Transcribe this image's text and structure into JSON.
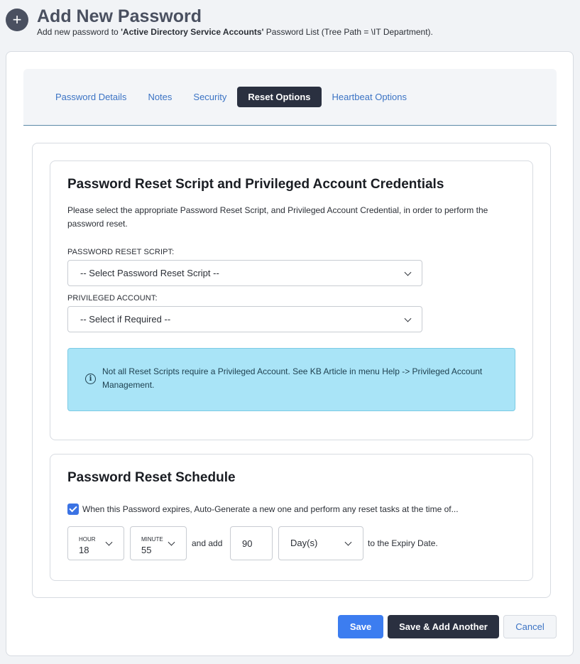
{
  "header": {
    "title": "Add New Password",
    "subtitle_prefix": "Add new password to ",
    "list_name": "'Active Directory Service Accounts'",
    "subtitle_suffix": " Password List (Tree Path = \\IT Department)."
  },
  "tabs": [
    {
      "label": "Password Details",
      "active": false
    },
    {
      "label": "Notes",
      "active": false
    },
    {
      "label": "Security",
      "active": false
    },
    {
      "label": "Reset Options",
      "active": true
    },
    {
      "label": "Heartbeat Options",
      "active": false
    }
  ],
  "reset_section": {
    "title": "Password Reset Script and Privileged Account Credentials",
    "description": "Please select the appropriate Password Reset Script, and Privileged Account Credential, in order to perform the password reset.",
    "script_label": "PASSWORD RESET SCRIPT:",
    "script_value": "-- Select Password Reset Script --",
    "account_label": "PRIVILEGED ACCOUNT:",
    "account_value": "-- Select if Required --",
    "info_text": "Not all Reset Scripts require a Privileged Account. See KB Article in menu Help -> Privileged Account Management."
  },
  "schedule_section": {
    "title": "Password Reset Schedule",
    "checkbox_label": "When this Password expires, Auto-Generate a new one and perform any reset tasks at the time of...",
    "checkbox_checked": true,
    "hour_label": "HOUR",
    "hour_value": "18",
    "minute_label": "MINUTE",
    "minute_value": "55",
    "and_add": "and add",
    "days_value": "90",
    "unit_value": "Day(s)",
    "suffix": "to the Expiry Date."
  },
  "buttons": {
    "save": "Save",
    "save_add": "Save & Add Another",
    "cancel": "Cancel"
  },
  "colors": {
    "accent": "#3c7df0",
    "dark": "#2a3040",
    "info_bg": "#a9e4f7"
  }
}
